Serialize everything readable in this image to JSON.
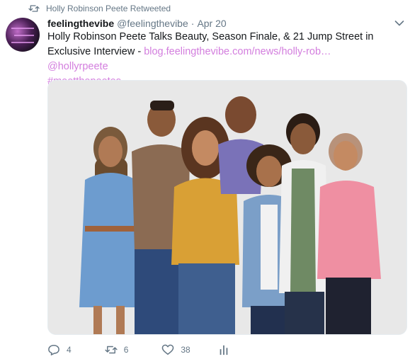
{
  "retweet_row": {
    "text": "Holly Robinson Peete Retweeted",
    "icon": "retweet-icon"
  },
  "tweet": {
    "author_name": "feelingthevibe",
    "author_handle": "@feelingthevibe",
    "separator": "·",
    "timestamp": "Apr 20",
    "text_before": "Holly Robinson Peete Talks Beauty, Season Finale, & 21 Jump Street in Exclusive Interview - ",
    "link_url": "blog.feelingthevibe.com/news/holly-rob…",
    "mention": "@hollyrpeete",
    "hashtag": "#meetthepeetes",
    "link_color": "#d37ede"
  },
  "actions": {
    "reply_count": "4",
    "retweet_count": "6",
    "like_count": "38"
  },
  "colors": {
    "text": "#14171a",
    "muted": "#657786",
    "link": "#d37ede"
  }
}
